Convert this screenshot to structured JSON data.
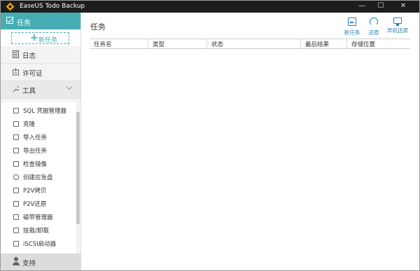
{
  "window": {
    "title": "EaseUS Todo Backup",
    "controls": [
      "—",
      "☐",
      "✕"
    ]
  },
  "sidebar": {
    "task_label": "任务",
    "new_task_label": "新任务",
    "nav": [
      {
        "label": "日志",
        "icon": "log-icon"
      },
      {
        "label": "许可证",
        "icon": "license-icon"
      },
      {
        "label": "工具",
        "icon": "wrench-icon"
      }
    ],
    "tools": [
      {
        "label": "SQL 凭据管理器",
        "icon": "database-icon"
      },
      {
        "label": "克隆",
        "icon": "clone-icon"
      },
      {
        "label": "导入任务",
        "icon": "import-icon"
      },
      {
        "label": "导出任务",
        "icon": "export-icon"
      },
      {
        "label": "检查镜像",
        "icon": "check-image-icon"
      },
      {
        "label": "创建应急盘",
        "icon": "emergency-disk-icon"
      },
      {
        "label": "P2V拷贝",
        "icon": "p2v-copy-icon"
      },
      {
        "label": "P2V还原",
        "icon": "p2v-restore-icon"
      },
      {
        "label": "磁带管理器",
        "icon": "tape-icon"
      },
      {
        "label": "挂载/卸载",
        "icon": "mount-icon"
      },
      {
        "label": "iSCSI启动器",
        "icon": "iscsi-icon"
      }
    ],
    "support_label": "支持"
  },
  "main": {
    "title": "任务",
    "toolbar": {
      "new_task": "新任务",
      "restore": "还原",
      "system_restore": "异机还原"
    },
    "columns": [
      "任务名",
      "类型",
      "状态",
      "最后结果",
      "存储位置"
    ]
  },
  "colors": {
    "accent": "#45adb3",
    "titlebar": "#1d1d1d",
    "link": "#2a7fb8"
  }
}
